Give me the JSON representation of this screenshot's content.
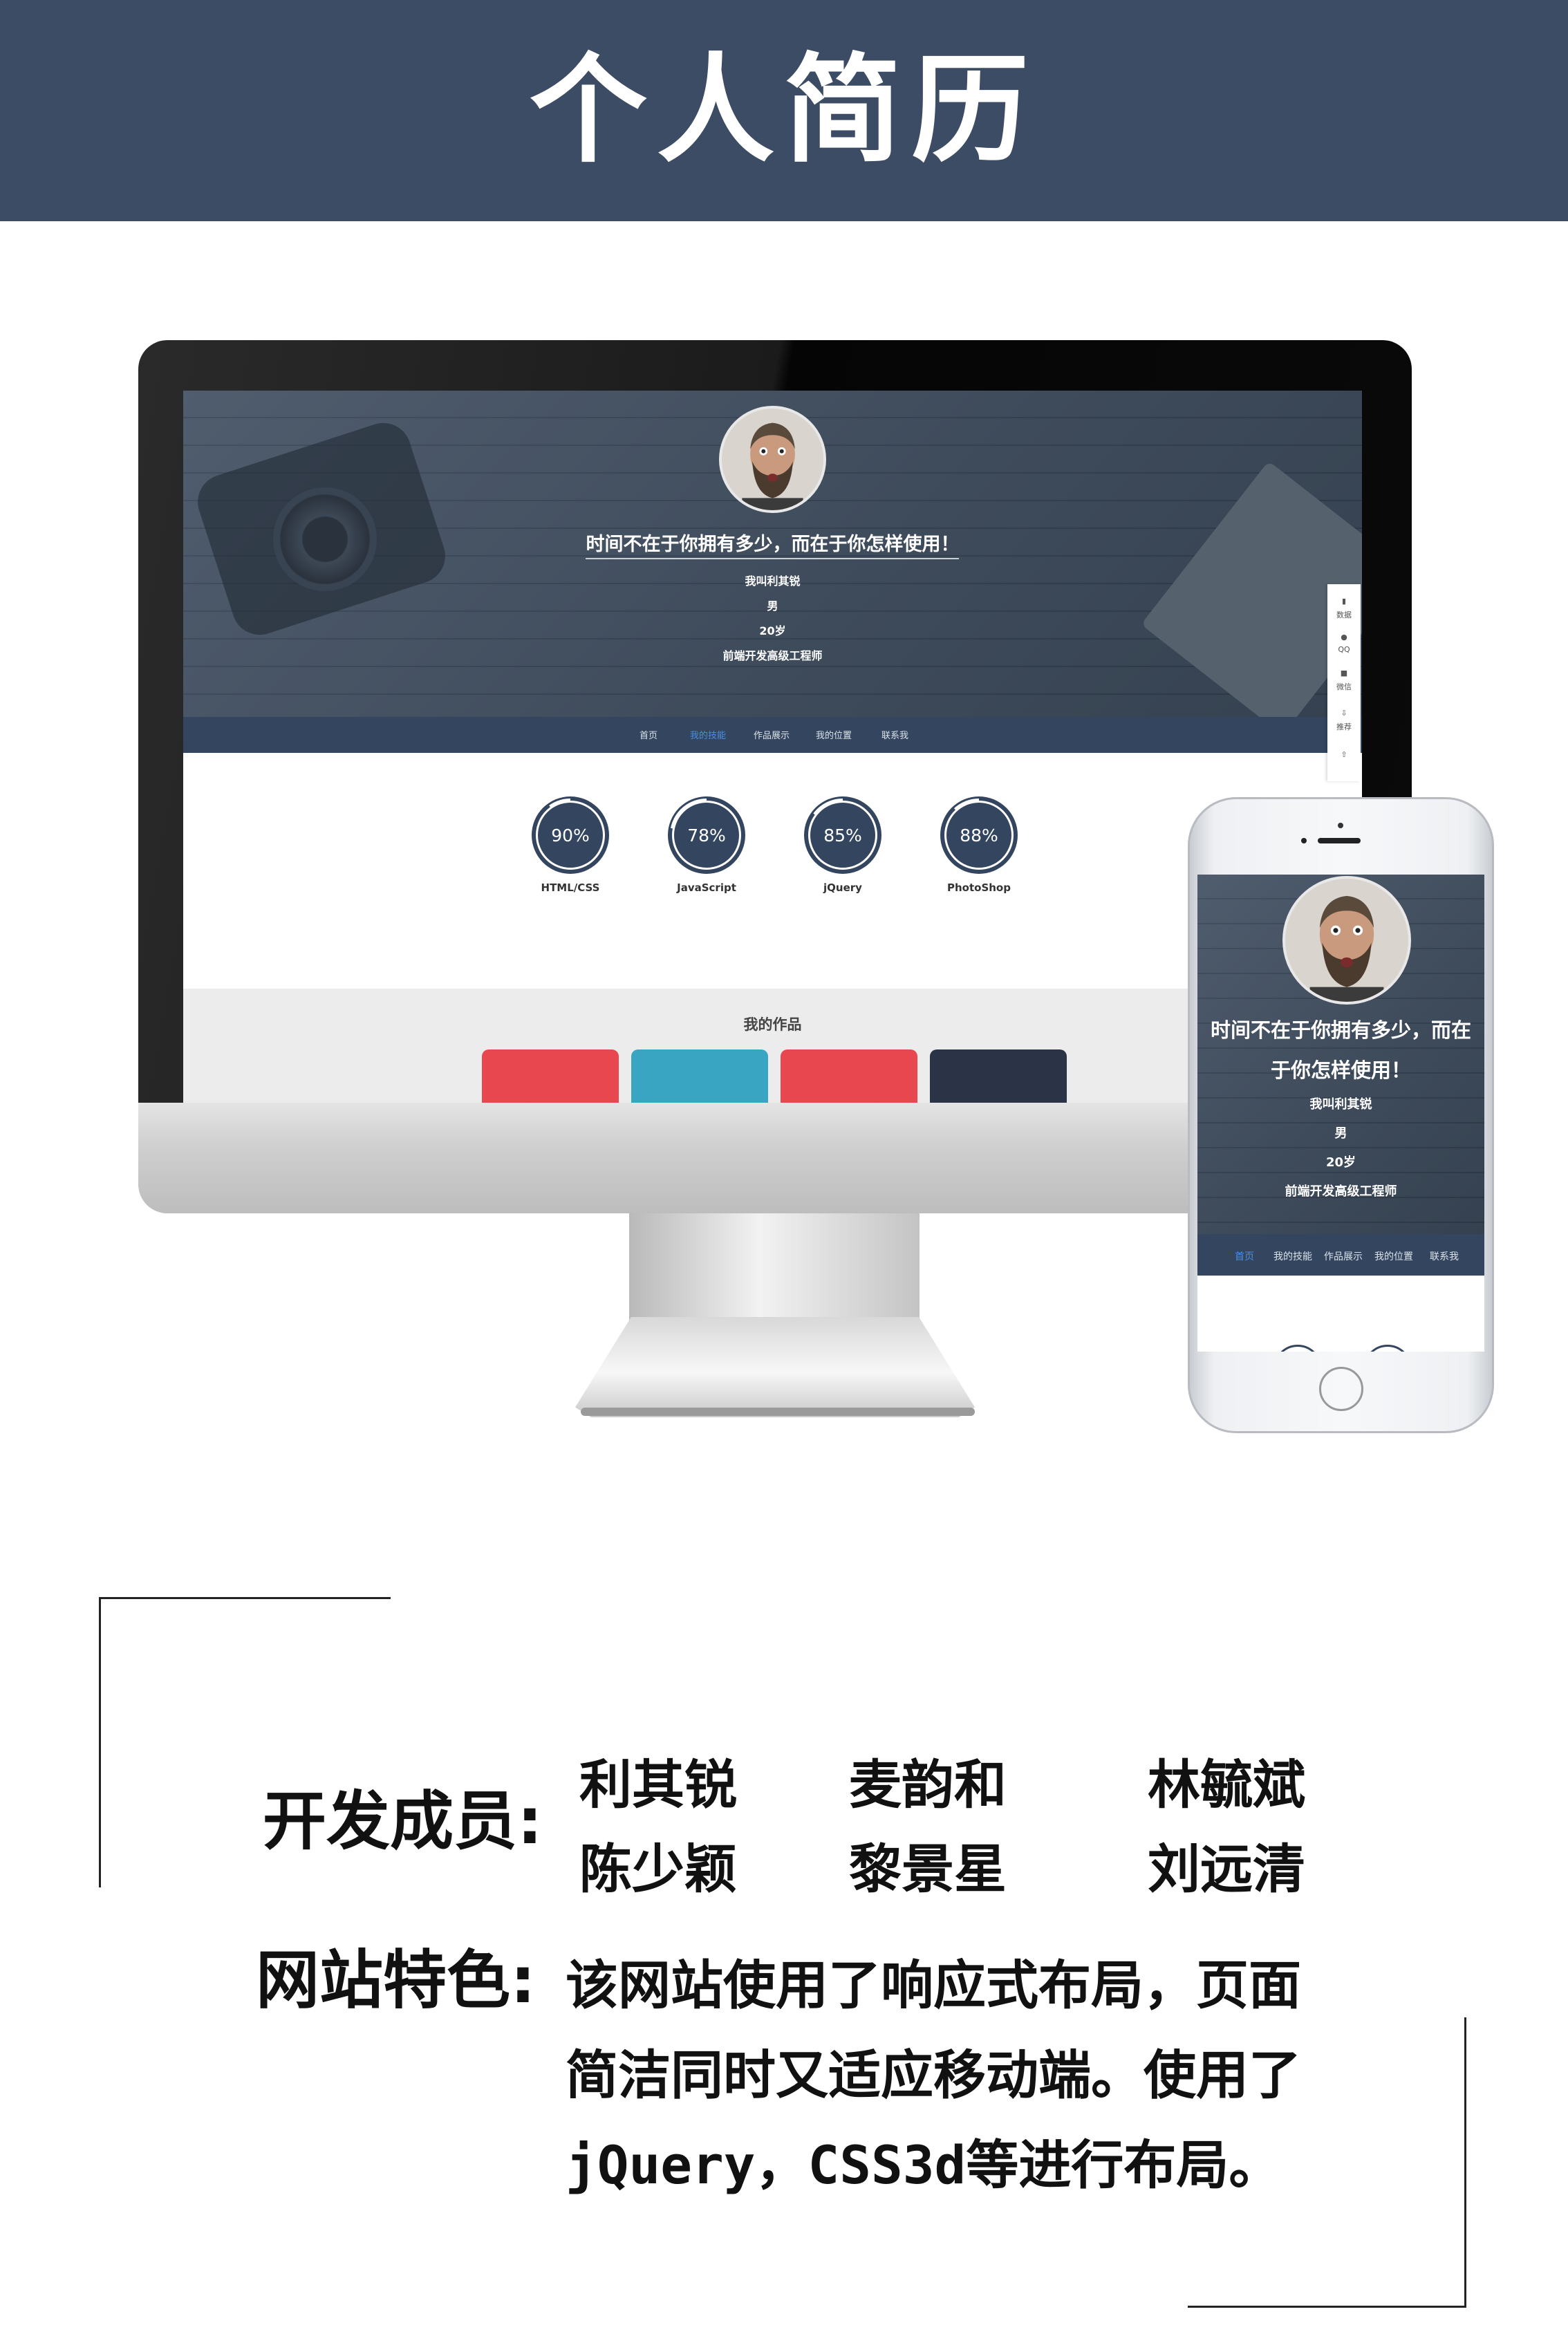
{
  "banner": {
    "title": "个人简历"
  },
  "desktop": {
    "hero": {
      "quote": "时间不在于你拥有多少，而在于你怎样使用！",
      "name": "我叫利其锐",
      "gender": "男",
      "age": "20岁",
      "job": "前端开发高级工程师"
    },
    "nav": [
      "首页",
      "我的技能",
      "作品展示",
      "我的位置",
      "联系我"
    ],
    "nav_active": "我的技能",
    "skills": [
      {
        "percent": 90,
        "label": "90%",
        "name": "HTML/CSS"
      },
      {
        "percent": 78,
        "label": "78%",
        "name": "JavaScript"
      },
      {
        "percent": 85,
        "label": "85%",
        "name": "jQuery"
      },
      {
        "percent": 88,
        "label": "88%",
        "name": "PhotoShop"
      }
    ],
    "works_title": "我的作品",
    "side_toolbar": [
      "数据",
      "QQ",
      "微信",
      "推荐"
    ]
  },
  "phone": {
    "hero": {
      "quote_line1": "时间不在于你拥有多少，而在",
      "quote_line2": "于你怎样使用！",
      "name": "我叫利其锐",
      "gender": "男",
      "age": "20岁",
      "job": "前端开发高级工程师"
    },
    "nav": [
      "首页",
      "我的技能",
      "作品展示",
      "我的位置",
      "联系我"
    ],
    "nav_active": "首页"
  },
  "info": {
    "members_label": "开发成员:",
    "members": [
      "利其锐",
      "麦韵和",
      "林毓斌",
      "陈少颖",
      "黎景星",
      "刘远清"
    ],
    "feature_label": "网站特色:",
    "feature_lines": [
      "该网站使用了响应式布局，页面",
      "简洁同时又适应移动端。使用了",
      "jQuery，CSS3d等进行布局。"
    ]
  },
  "colors": {
    "banner": "#3b4c64",
    "nav": "#34465f",
    "nav_active": "#4a8fe0",
    "work_cards": [
      "#e9474f",
      "#3aa5c3",
      "#e9474f",
      "#2b3447"
    ]
  }
}
